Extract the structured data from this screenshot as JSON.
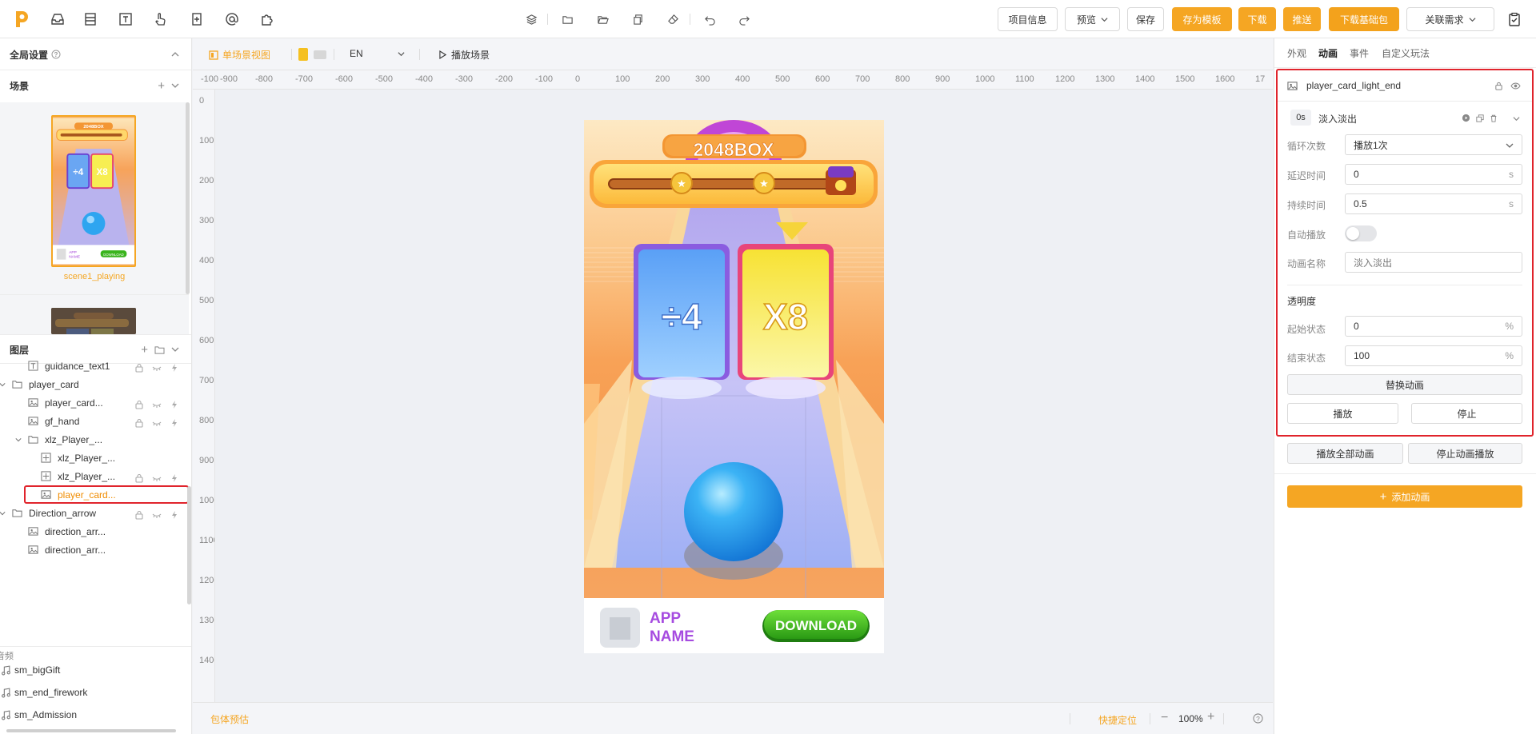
{
  "toolbar": {
    "project_info": "项目信息",
    "preview": "预览",
    "save": "保存",
    "save_template": "存为模板",
    "download": "下载",
    "push": "推送",
    "download_base": "下载基础包",
    "linked_request": "关联需求"
  },
  "left": {
    "global_settings": "全局设置",
    "scene_header": "场景",
    "scene1_name": "scene1_playing",
    "layers_header": "图层",
    "layers": [
      {
        "label": "guidance_text1",
        "icon": "text-icon",
        "indent": 1
      },
      {
        "label": "player_card",
        "icon": "folder-icon",
        "indent": 0,
        "expanded": true
      },
      {
        "label": "player_card...",
        "icon": "image-icon",
        "indent": 2
      },
      {
        "label": "gf_hand",
        "icon": "image-icon",
        "indent": 2
      },
      {
        "label": "xlz_Player_...",
        "icon": "folder-icon",
        "indent": 1,
        "expanded": true
      },
      {
        "label": "xlz_Player_...",
        "icon": "component-icon",
        "indent": 3
      },
      {
        "label": "xlz_Player_...",
        "icon": "component-icon",
        "indent": 3
      },
      {
        "label": "player_card...",
        "icon": "image-icon",
        "indent": 3,
        "selected": true
      },
      {
        "label": "Direction_arrow",
        "icon": "folder-icon",
        "indent": 0,
        "expanded": true
      },
      {
        "label": "direction_arr...",
        "icon": "image-icon",
        "indent": 2
      },
      {
        "label": "direction_arr...",
        "icon": "image-icon",
        "indent": 2
      }
    ],
    "audio_header": "音频",
    "audio": [
      "sm_bigGift",
      "sm_end_firework",
      "sm_Admission"
    ]
  },
  "canvas": {
    "view_mode": "单场景视图",
    "lang": "EN",
    "play_scene": "播放场景",
    "bottom_left": "包体预估",
    "locate": "快捷定位",
    "zoom": "100%",
    "ruler_x": [
      "-100",
      "-900",
      "-800",
      "-700",
      "-600",
      "-500",
      "-400",
      "-300",
      "-200",
      "-100",
      "0",
      "100",
      "200",
      "300",
      "400",
      "500",
      "600",
      "700",
      "800",
      "900",
      "1000",
      "1100",
      "1200",
      "1300",
      "1400",
      "1500",
      "1600",
      "17"
    ],
    "ruler_y": [
      "0",
      "100",
      "200",
      "300",
      "400",
      "500",
      "600",
      "700",
      "800",
      "900",
      "1000",
      "1100",
      "1200",
      "1300",
      "1400"
    ]
  },
  "game": {
    "title": "2048BOX",
    "card_left": "÷4",
    "card_right": "X8",
    "app_line1": "APP",
    "app_line2": "NAME",
    "download": "DOWNLOAD",
    "mini_app": "APP NAME",
    "mini_download": "DOWNLOAD"
  },
  "right": {
    "tabs": [
      "外观",
      "动画",
      "事件",
      "自定义玩法"
    ],
    "active_tab": "动画",
    "element_name": "player_card_light_end",
    "time_badge": "0s",
    "anim_type": "淡入淡出",
    "loop_label": "循环次数",
    "loop_value": "播放1次",
    "delay_label": "延迟时间",
    "delay_value": "0",
    "duration_label": "持续时间",
    "duration_value": "0.5",
    "unit_s": "s",
    "autoplay_label": "自动播放",
    "anim_name_label": "动画名称",
    "anim_name_placeholder": "淡入淡出",
    "opacity_header": "透明度",
    "start_label": "起始状态",
    "start_value": "0",
    "end_label": "结束状态",
    "end_value": "100",
    "unit_pct": "%",
    "replace": "替换动画",
    "play": "播放",
    "stop": "停止",
    "play_all": "播放全部动画",
    "stop_play": "停止动画播放",
    "add": "添加动画"
  },
  "colors": {
    "accent": "#f5a623",
    "selected_text": "#f08c00",
    "highlight_border": "#e0242c"
  }
}
